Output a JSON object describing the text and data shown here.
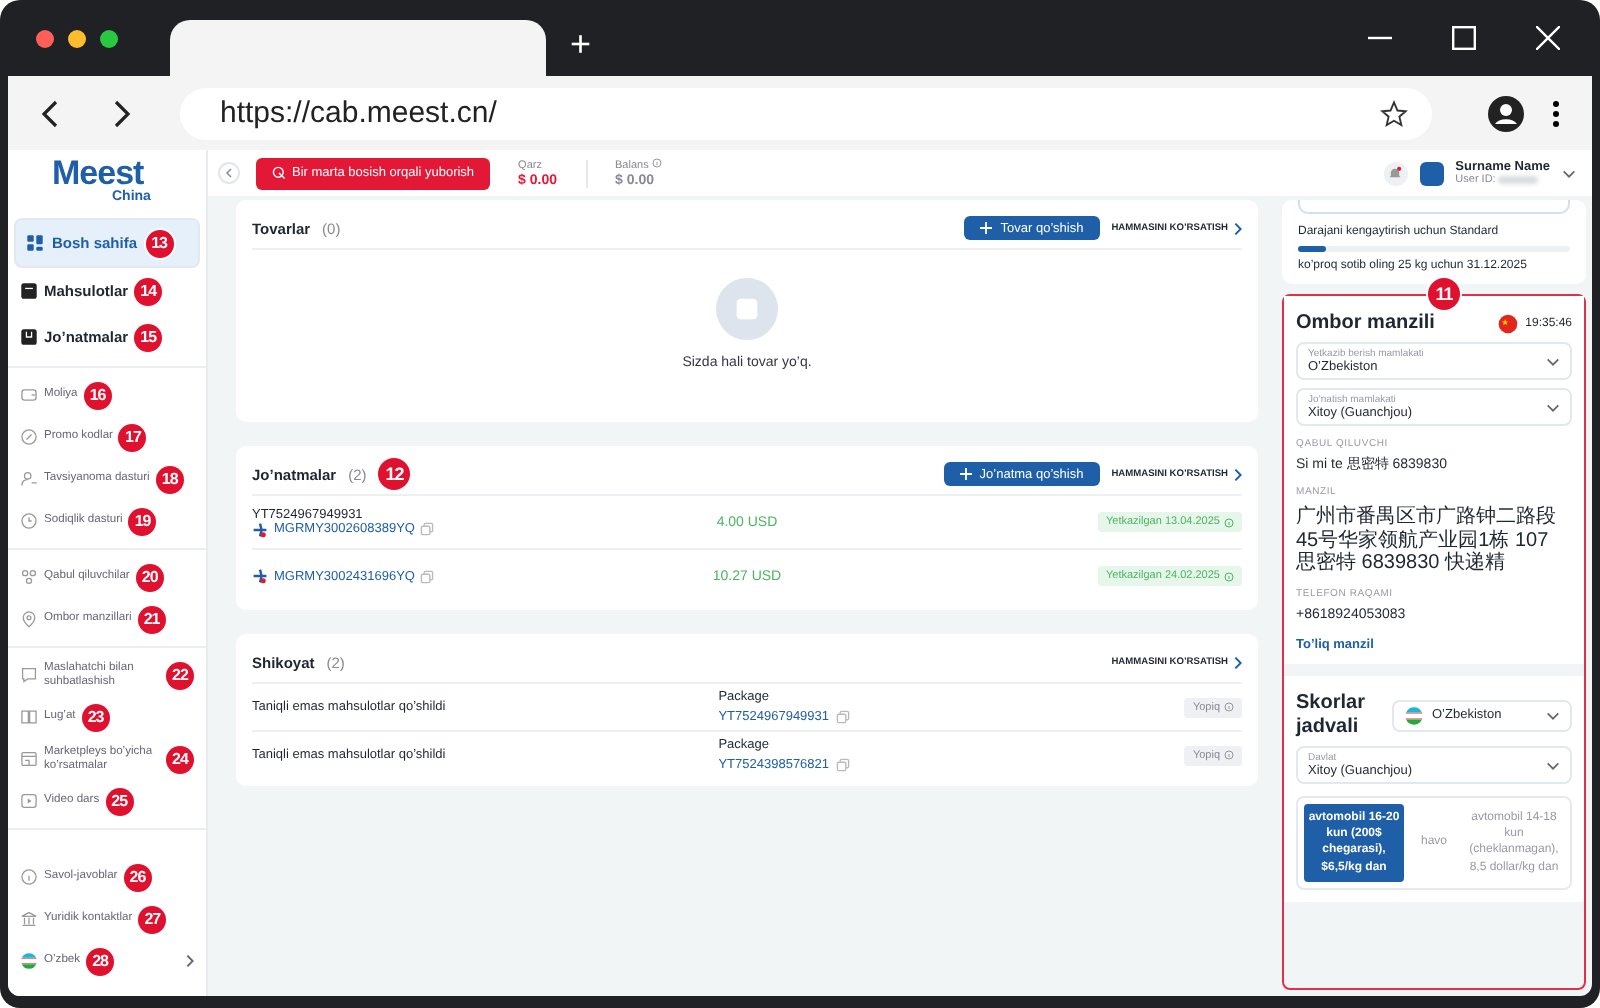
{
  "browser": {
    "new_tab": "+",
    "url": "https://cab.meest.cn/"
  },
  "logo": {
    "name": "Meest",
    "region": "China"
  },
  "topbar": {
    "send_button": "Bir marta bosish orqali yuborish",
    "debt": {
      "label": "Qarz",
      "value": "$ 0.00"
    },
    "balance": {
      "label": "Balans",
      "value": "$ 0.00"
    },
    "user": {
      "name": "Surname Name",
      "id_label": "User ID:"
    }
  },
  "sidebar": {
    "groups": [
      {
        "kind": "primary",
        "items": [
          {
            "label": "Bosh sahifa",
            "badge": "13",
            "selected": true
          },
          {
            "label": "Mahsulotlar",
            "badge": "14",
            "selected": false
          },
          {
            "label": "Jo’natmalar",
            "badge": "15",
            "selected": false
          }
        ]
      },
      {
        "kind": "secondary",
        "items": [
          {
            "label": "Moliya",
            "badge": "16",
            "selected": false
          },
          {
            "label": "Promo kodlar",
            "badge": "17",
            "selected": false
          },
          {
            "label": "Tavsiyanoma dasturi",
            "badge": "18",
            "selected": false
          },
          {
            "label": "Sodiqlik dasturi",
            "badge": "19",
            "selected": false
          }
        ]
      },
      {
        "kind": "secondary",
        "items": [
          {
            "label": "Qabul qiluvchilar",
            "badge": "20",
            "selected": false
          },
          {
            "label": "Ombor manzillari",
            "badge": "21",
            "selected": false
          }
        ]
      },
      {
        "kind": "secondary",
        "items": [
          {
            "label": "Maslahatchi bilan suhbatlashish",
            "badge": "22",
            "selected": false
          },
          {
            "label": "Lug’at",
            "badge": "23",
            "selected": false
          },
          {
            "label": "Marketpleys bo’yicha ko’rsatmalar",
            "badge": "24",
            "selected": false
          },
          {
            "label": "Video dars",
            "badge": "25",
            "selected": false
          }
        ]
      },
      {
        "kind": "footer",
        "items": [
          {
            "label": "Savol-javoblar",
            "badge": "26",
            "selected": false
          },
          {
            "label": "Yuridik kontaktlar",
            "badge": "27",
            "selected": false
          },
          {
            "label": "O’zbek",
            "badge": "28",
            "selected": false
          }
        ]
      }
    ]
  },
  "products": {
    "title": "Tovarlar",
    "count": "(0)",
    "add_button": "Tovar qo’shish",
    "show_all": "HAMMASINI KO’RSATISH",
    "empty_text": "Sizda hali tovar yo’q."
  },
  "shipments": {
    "title": "Jo’natmalar",
    "count": "(2)",
    "badge": "12",
    "add_button": "Jo’natma qo’shish",
    "show_all": "HAMMASINI KO’RSATISH",
    "rows": [
      {
        "track": "YT7524967949931",
        "code": "MGRMY3002608389YQ",
        "amount": "4.00 USD",
        "status": "Yetkazilgan 13.04.2025"
      },
      {
        "code": "MGRMY3002431696YQ",
        "amount": "10.27 USD",
        "status": "Yetkazilgan 24.02.2025"
      }
    ]
  },
  "complaints": {
    "title": "Shikoyat",
    "count": "(2)",
    "show_all": "HAMMASINI KO’RSATISH",
    "rows": [
      {
        "description": "Taniqli emas mahsulotlar qo’shildi",
        "type": "Package",
        "track": "YT7524967949931",
        "status": "Yopiq"
      },
      {
        "description": "Taniqli emas mahsulotlar qo’shildi",
        "type": "Package",
        "track": "YT7524398576821",
        "status": "Yopiq"
      }
    ]
  },
  "level_card": {
    "text": "Darajani kengaytirish uchun Standard",
    "level": 0.1,
    "note": "ko’proq sotib oling 25 kg uchun 31.12.2025"
  },
  "warehouse": {
    "badge": "11",
    "title": "Ombor manzili",
    "time": "19:35:46",
    "selects": [
      {
        "label": "Yetkazib berish mamlakati",
        "value": "O’Zbekiston"
      },
      {
        "label": "Jo’natish mamlakati",
        "value": "Xitoy (Guanchjou)"
      }
    ],
    "fields": [
      {
        "label": "QABUL QILUVCHI",
        "value": "Si mi te 思密特 6839830"
      },
      {
        "label": "MANZIL",
        "value": "广州市番禺区市广路钟二路段45号华家领航产业园1栋 107 思密特 6839830 快递精"
      },
      {
        "label": "TELEFON RAQAMI",
        "value": "+8618924053083"
      }
    ],
    "link": "To’liq manzil"
  },
  "rates": {
    "title": "Skorlar jadvali",
    "country": "O’Zbekiston",
    "select": {
      "label": "Davlat",
      "value": "Xitoy (Guanchjou)"
    },
    "options": [
      {
        "text": "avtomobil 16-20 kun (200$ chegarasi), $6,5/kg dan",
        "selected": true
      },
      {
        "text": "havo",
        "selected": false
      },
      {
        "text": "avtomobil 14-18 kun (cheklanmagan), 8,5 dollar/kg dan",
        "selected": false
      }
    ]
  }
}
